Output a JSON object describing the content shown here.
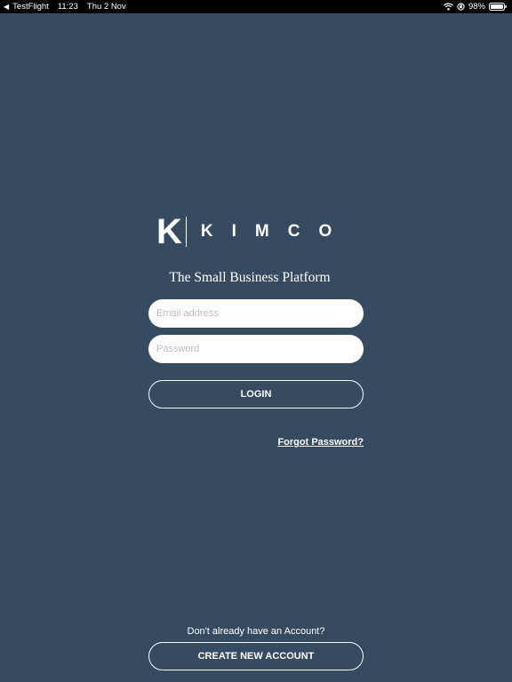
{
  "status_bar": {
    "back_app": "TestFlight",
    "time": "11:23",
    "date": "Thu 2 Nov",
    "battery": "98%"
  },
  "logo": {
    "mark": "K",
    "name": "KIMCO"
  },
  "tagline": "The Small Business Platform",
  "form": {
    "email_placeholder": "Email address",
    "password_placeholder": "Password",
    "login_label": "LOGIN",
    "forgot_label": "Forgot Password?"
  },
  "footer": {
    "prompt": "Don't already have an Account?",
    "create_label": "CREATE NEW ACCOUNT"
  },
  "colors": {
    "background": "#364a60",
    "status_bar": "#000000",
    "text": "#ffffff"
  }
}
